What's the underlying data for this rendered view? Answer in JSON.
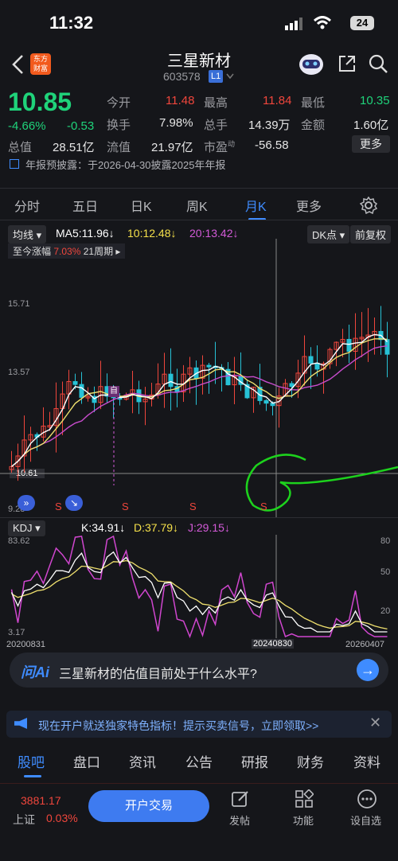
{
  "status_bar": {
    "time": "11:32",
    "battery": "24"
  },
  "header": {
    "title": "三星新材",
    "code": "603578",
    "level_badge": "L1",
    "logo_text": "东方财富"
  },
  "quote": {
    "price": "10.85",
    "change_pct": "-4.66%",
    "change": "-0.53",
    "open_label": "今开",
    "open": "11.48",
    "high_label": "最高",
    "high": "11.84",
    "low_label": "最低",
    "low": "10.35",
    "turnover_label": "换手",
    "turnover": "7.98%",
    "volume_label": "总手",
    "volume": "14.39万",
    "amount_label": "金额",
    "amount": "1.60亿",
    "mktcap_label": "总值",
    "mktcap": "28.51亿",
    "float_label": "流值",
    "float": "21.97亿",
    "pe_label": "市盈",
    "pe_sup": "动",
    "pe": "-56.58",
    "more_button": "更多"
  },
  "notice": {
    "text": "年报预披露：于2026-04-30披露2025年年报"
  },
  "period_tabs": [
    "分时",
    "五日",
    "日K",
    "周K",
    "月K",
    "更多"
  ],
  "active_tab": "月K",
  "indicator_bar": {
    "main_label": "均线",
    "ma5": "MA5:11.96",
    "ma10": "10:12.48",
    "ma20": "20:13.42",
    "dk_label": "DK点",
    "adjust_label": "前复权"
  },
  "range_stat": {
    "label": "至今涨幅",
    "value": "7.03%",
    "period": "21周期"
  },
  "price_axis": [
    "15.71",
    "13.57",
    "10.61",
    "9.28"
  ],
  "kdj": {
    "label": "KDJ",
    "k": "K:34.91",
    "d": "D:37.79",
    "j": "J:29.15",
    "top_left": "83.62",
    "bottom_left": "3.17",
    "levels": [
      "80",
      "50",
      "20"
    ]
  },
  "dates": {
    "start": "20200831",
    "cursor": "20240830",
    "end": "20260407"
  },
  "signal_label": "S",
  "ai_bar": {
    "brand": "问Ai",
    "question": "三星新材的估值目前处于什么水平?"
  },
  "promo": {
    "text": "现在开户就送独家特色指标！提示买卖信号，立即领取>>"
  },
  "bottom_tabs": [
    "股吧",
    "盘口",
    "资讯",
    "公告",
    "研报",
    "财务",
    "资料"
  ],
  "index": {
    "value": "3881.17",
    "name": "上证",
    "pct": "0.03%"
  },
  "open_account": "开户交易",
  "bottom_actions": [
    "发帖",
    "功能",
    "设自选"
  ],
  "colors": {
    "up": "#f0463c",
    "down": "#1fd37a",
    "accent": "#3f8cff",
    "candle_down": "#27c2d6"
  },
  "chart_data": {
    "type": "candlestick",
    "x": [
      "20200831",
      "20240830",
      "20260407"
    ],
    "ylim": [
      9.28,
      17.0
    ],
    "series": [
      {
        "name": "MA5",
        "values": [
          11.96
        ]
      },
      {
        "name": "10",
        "values": [
          12.48
        ]
      },
      {
        "name": "20",
        "values": [
          13.42
        ]
      }
    ]
  }
}
